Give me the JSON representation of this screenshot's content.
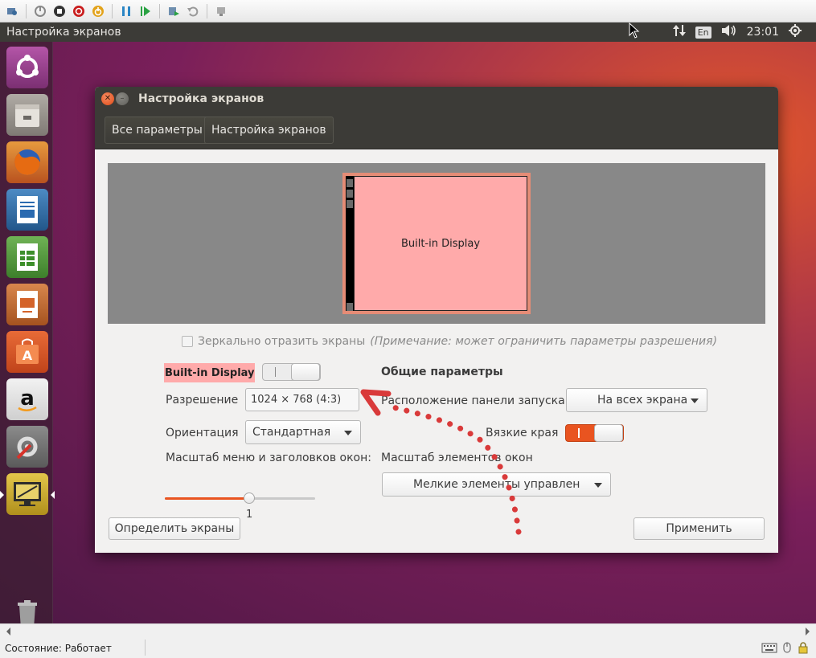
{
  "host": {
    "status": "Состояние: Работает"
  },
  "topbar": {
    "title": "Настройка экранов",
    "lang": "En",
    "clock": "23:01"
  },
  "dialog": {
    "title": "Настройка экранов",
    "crumbs": [
      "Все параметры",
      "Настройка экранов"
    ],
    "preview_label": "Built-in Display",
    "mirror_label": "Зеркально отразить экраны",
    "mirror_note": "(Примечание: может ограничить параметры разрешения)",
    "display_name": "Built-in Display",
    "display_enabled": false,
    "resolution_label": "Разрешение",
    "resolution_value": "1024 × 768 (4:3)",
    "orientation_label": "Ориентация",
    "orientation_value": "Стандартная",
    "scale_label": "Масштаб меню и заголовков окон:",
    "scale_value": "1",
    "scale_fraction": 0.56,
    "general_title": "Общие параметры",
    "launcher_label": "Расположение панели запуска",
    "launcher_value": "На всех экрана",
    "sticky_label": "Вязкие края",
    "sticky_enabled": true,
    "elements_scale_label": "Масштаб элементов окон",
    "elements_scale_value": "Мелкие элементы управлен",
    "detect_button": "Определить экраны",
    "apply_button": "Применить"
  },
  "colors": {
    "accent": "#e95420",
    "display_highlight": "#ffaaaa",
    "annotation": "#d93a3a"
  }
}
